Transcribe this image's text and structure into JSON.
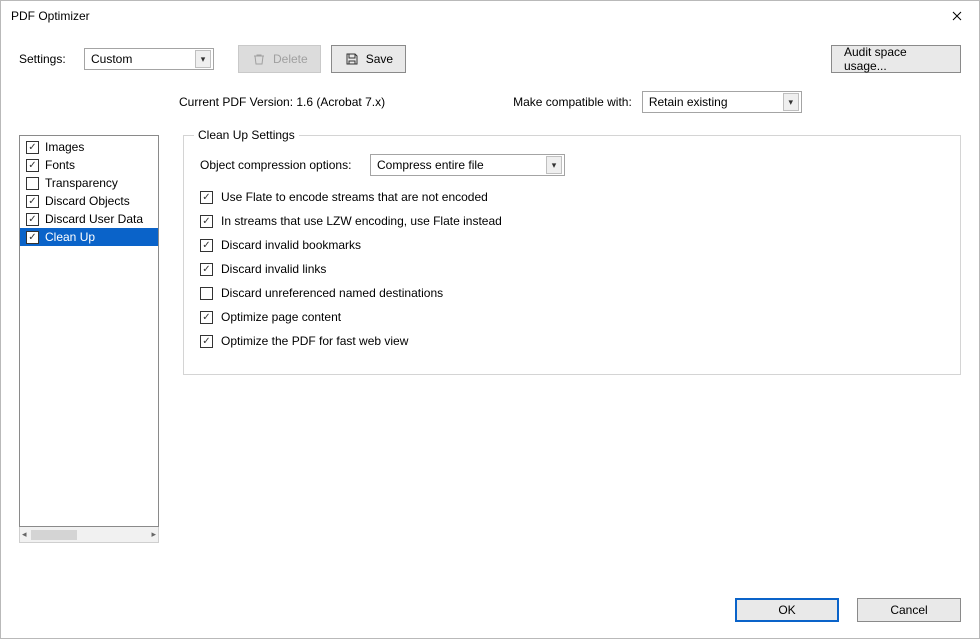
{
  "window": {
    "title": "PDF Optimizer"
  },
  "toolbar": {
    "settings_label": "Settings:",
    "settings_value": "Custom",
    "delete_label": "Delete",
    "save_label": "Save",
    "audit_label": "Audit space usage..."
  },
  "info": {
    "current_version_text": "Current PDF Version: 1.6 (Acrobat 7.x)",
    "compat_label": "Make compatible with:",
    "compat_value": "Retain existing"
  },
  "sidebar": {
    "items": [
      {
        "label": "Images",
        "checked": true,
        "selected": false
      },
      {
        "label": "Fonts",
        "checked": true,
        "selected": false
      },
      {
        "label": "Transparency",
        "checked": false,
        "selected": false
      },
      {
        "label": "Discard Objects",
        "checked": true,
        "selected": false
      },
      {
        "label": "Discard User Data",
        "checked": true,
        "selected": false
      },
      {
        "label": "Clean Up",
        "checked": true,
        "selected": true
      }
    ]
  },
  "panel": {
    "title": "Clean Up Settings",
    "oc_label": "Object compression options:",
    "oc_value": "Compress entire file",
    "checks": [
      {
        "label": "Use Flate to encode streams that are not encoded",
        "checked": true
      },
      {
        "label": "In streams that use LZW encoding, use Flate instead",
        "checked": true
      },
      {
        "label": "Discard invalid bookmarks",
        "checked": true
      },
      {
        "label": "Discard invalid links",
        "checked": true
      },
      {
        "label": "Discard unreferenced named destinations",
        "checked": false
      },
      {
        "label": "Optimize page content",
        "checked": true
      },
      {
        "label": "Optimize the PDF for fast web view",
        "checked": true
      }
    ]
  },
  "footer": {
    "ok_label": "OK",
    "cancel_label": "Cancel"
  }
}
